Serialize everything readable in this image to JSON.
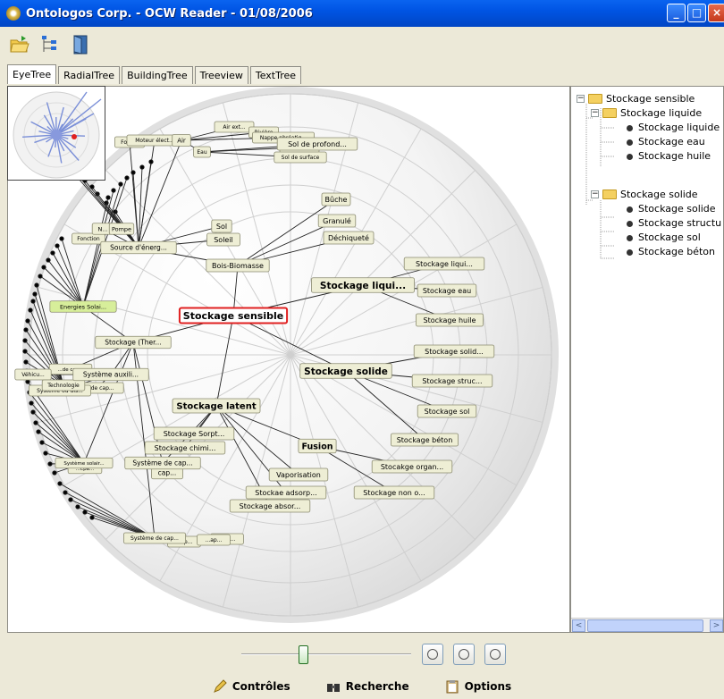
{
  "window": {
    "title": "Ontologos Corp. - OCW Reader - 01/08/2006"
  },
  "toolbar": {
    "icons": [
      "open-folder-icon",
      "tree-view-icon",
      "exit-door-icon"
    ]
  },
  "tabs": [
    {
      "label": "EyeTree",
      "active": true
    },
    {
      "label": "RadialTree"
    },
    {
      "label": "BuildingTree"
    },
    {
      "label": "Treeview"
    },
    {
      "label": "TextTree"
    }
  ],
  "graph": {
    "focus": "Stockage sensible",
    "nodes": [
      {
        "label": "Stockage liqui...",
        "bold": true
      },
      {
        "label": "Stockage solide",
        "bold": true
      },
      {
        "label": "Stockage latent",
        "bold": true
      },
      {
        "label": "Fusion",
        "bold": true
      },
      {
        "label": "Stockage liqui..."
      },
      {
        "label": "Stockage eau"
      },
      {
        "label": "Stockage huile"
      },
      {
        "label": "Stockage solid..."
      },
      {
        "label": "Stockage struc..."
      },
      {
        "label": "Stockage sol"
      },
      {
        "label": "Stockage béton"
      },
      {
        "label": "Stocakge organ..."
      },
      {
        "label": "Stockage non o..."
      },
      {
        "label": "Vaporisation"
      },
      {
        "label": "Stockae adsorp..."
      },
      {
        "label": "Stockage absor..."
      },
      {
        "label": "Stockage Sorpt..."
      },
      {
        "label": "Stockage chimi..."
      },
      {
        "label": "Système de cap..."
      },
      {
        "label": "cap..."
      },
      {
        "label": "Stockage (Ther..."
      },
      {
        "label": "Système auxili..."
      },
      {
        "label": "Bois-Biomasse"
      },
      {
        "label": "Bûche"
      },
      {
        "label": "Granulé"
      },
      {
        "label": "Déchiqueté"
      },
      {
        "label": "Sol"
      },
      {
        "label": "Soleil"
      },
      {
        "label": "Source d'énerg..."
      },
      {
        "label": "Sol de profond..."
      },
      {
        "label": "Sol de surface"
      },
      {
        "label": "Eau de mer"
      },
      {
        "label": "Nappe phréatiq..."
      },
      {
        "label": "Rivière"
      },
      {
        "label": "Air ext..."
      },
      {
        "label": "Air"
      },
      {
        "label": "Eau"
      },
      {
        "label": "Moteur élect..."
      },
      {
        "label": "Fonc..."
      },
      {
        "label": "Pompe"
      },
      {
        "label": "N..."
      },
      {
        "label": "Fonction"
      },
      {
        "label": "Energies Solai..."
      },
      {
        "label": "Technologie"
      },
      {
        "label": "Système ou dis..."
      },
      {
        "label": "...e de cap..."
      },
      {
        "label": "Véhicu..."
      },
      {
        "label": "Système solair..."
      },
      {
        "label": "Système de cap..."
      },
      {
        "label": "...ap..."
      },
      {
        "label": "...ap..."
      },
      {
        "label": "...ap..."
      },
      {
        "label": "...cpa..."
      },
      {
        "label": "...de cap..."
      }
    ]
  },
  "tree": {
    "root": "Stockage sensible",
    "groups": [
      {
        "label": "Stockage liquide",
        "children": [
          "Stockage liquide",
          "Stockage eau",
          "Stockage huile"
        ]
      },
      {
        "label": "Stockage solide",
        "children": [
          "Stockage solide",
          "Stockage structu",
          "Stockage sol",
          "Stockage béton"
        ]
      }
    ]
  },
  "bottom": {
    "controls": "Contrôles",
    "search": "Recherche",
    "options": "Options"
  },
  "colors": {
    "node_fill": "#eeeed5",
    "focus_border": "#e02020",
    "title_bar": "#0054e3"
  }
}
